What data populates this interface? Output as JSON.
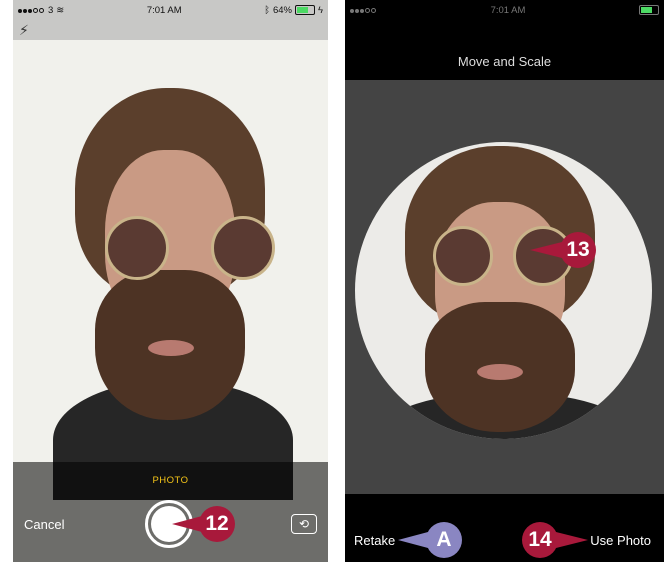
{
  "left_screen": {
    "status": {
      "carrier": "3",
      "time": "7:01 AM",
      "battery": "64%"
    },
    "mode_label": "PHOTO",
    "cancel_label": "Cancel",
    "icons": {
      "flash": "flash-off-icon",
      "switch": "switch-camera-icon"
    }
  },
  "right_screen": {
    "title": "Move and Scale",
    "retake_label": "Retake",
    "use_photo_label": "Use Photo"
  },
  "callouts": {
    "c12": "12",
    "c13": "13",
    "c14": "14",
    "ca": "A"
  },
  "colors": {
    "callout_red": "#a8193b",
    "callout_purple": "#8a86c2",
    "photo_yellow": "#f5c518"
  }
}
